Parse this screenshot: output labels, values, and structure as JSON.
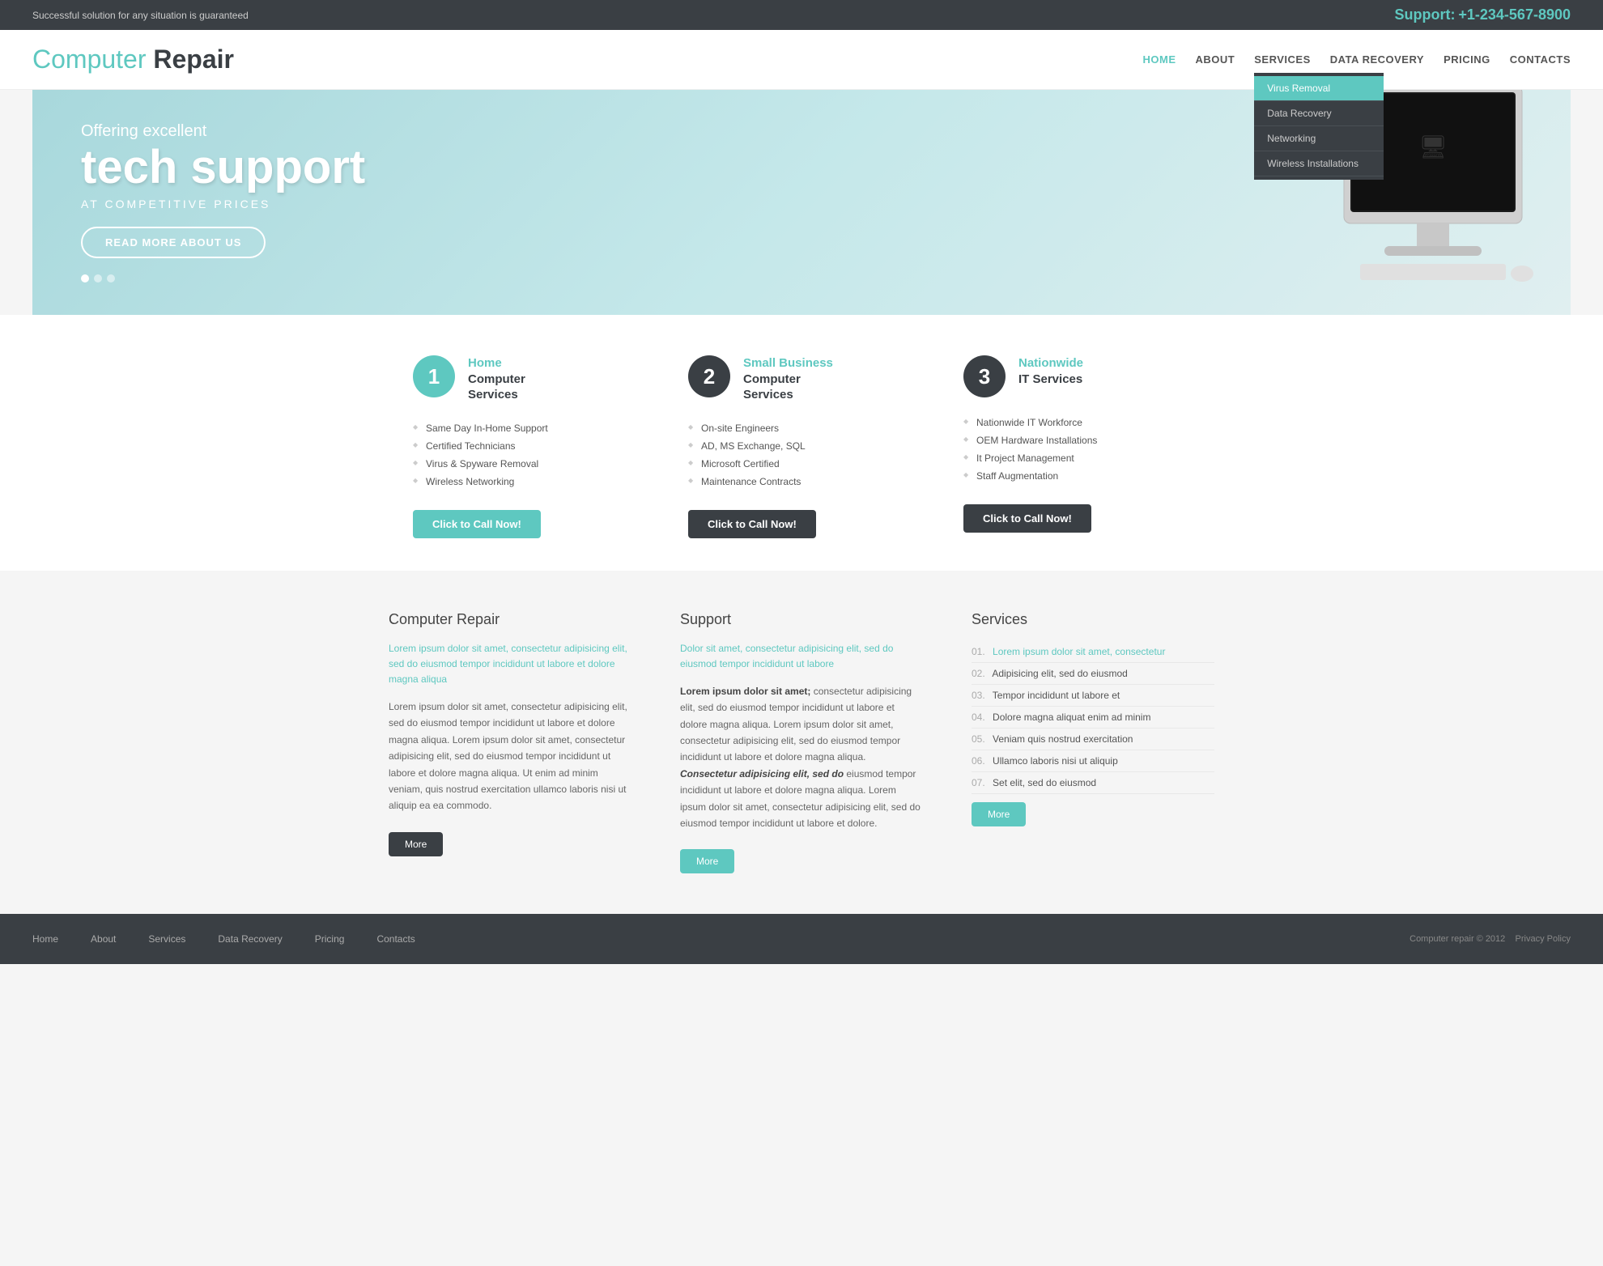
{
  "topbar": {
    "tagline": "Successful solution for any situation is guaranteed",
    "support_label": "Support:",
    "phone": "+1-234-567-8900"
  },
  "header": {
    "logo_teal": "Computer ",
    "logo_bold": "Repair",
    "nav": {
      "items": [
        {
          "label": "HOME",
          "active": true
        },
        {
          "label": "ABOUT",
          "active": false
        },
        {
          "label": "SERVICES",
          "active": false,
          "has_dropdown": true
        },
        {
          "label": "DATA RECOVERY",
          "active": false
        },
        {
          "label": "PRICING",
          "active": false
        },
        {
          "label": "CONTACTS",
          "active": false
        }
      ],
      "dropdown": [
        {
          "label": "Virus Removal",
          "active": true
        },
        {
          "label": "Data Recovery",
          "active": false
        },
        {
          "label": "Networking",
          "active": false
        },
        {
          "label": "Wireless Installations",
          "active": false
        }
      ]
    }
  },
  "hero": {
    "offering": "Offering excellent",
    "headline": "tech support",
    "subheadline": "AT COMPETITIVE PRICES",
    "cta_label": "READ MORE ABOUT US",
    "dots": 3
  },
  "services": [
    {
      "number": "1",
      "dark": false,
      "title_teal": "Home",
      "title_dark": "Computer Services",
      "items": [
        "Same Day In-Home Support",
        "Certified Technicians",
        "Virus & Spyware Removal",
        "Wireless Networking"
      ],
      "btn_label": "Click to Call Now!",
      "btn_dark": false
    },
    {
      "number": "2",
      "dark": true,
      "title_teal": "Small Business",
      "title_dark": "Computer Services",
      "items": [
        "On-site Engineers",
        "AD, MS Exchange, SQL",
        "Microsoft Certified",
        "Maintenance Contracts"
      ],
      "btn_label": "Click to Call Now!",
      "btn_dark": true
    },
    {
      "number": "3",
      "dark": true,
      "title_teal": "Nationwide",
      "title_dark": "IT Services",
      "items": [
        "Nationwide IT Workforce",
        "OEM Hardware Installations",
        "It Project Management",
        "Staff Augmentation"
      ],
      "btn_label": "Click to Call Now!",
      "btn_dark": true
    }
  ],
  "info": {
    "columns": [
      {
        "heading": "Computer Repair",
        "teal_text": "Lorem ipsum dolor sit amet, consectetur adipisicing elit, sed do eiusmod tempor incididunt ut labore et dolore magna aliqua",
        "body": "Lorem ipsum dolor sit amet, consectetur adipisicing elit, sed do eiusmod tempor incididunt ut labore et dolore magna aliqua.  Lorem ipsum dolor sit amet, consectetur adipisicing elit, sed do eiusmod tempor incididunt ut labore et dolore magna aliqua.  Ut enim ad minim veniam, quis nostrud exercitation ullamco laboris nisi ut aliquip ea ea commodo.",
        "btn_label": "More",
        "btn_dark": true
      },
      {
        "heading": "Support",
        "teal_text": "Dolor sit amet, consectetur adipisicing elit, sed do eiusmod tempor incididunt ut labore",
        "body": "Lorem ipsum dolor sit amet, consectetur adipisicing elit, sed do eiusmod tempor incididunt ut labore et dolore magna aliqua.  Lorem ipsum dolor sit amet, consectetur adipisicing elit, sed do eiusmod tempor incididunt ut labore et dolore magna aliqua.  Consectetur adipisicing elit, sed do eiusmod tempor incididunt ut labore et dolore magna aliqua.  Lorem ipsum dolor sit amet, consectetur adipisicing elit, sed do eiusmod tempor incididunt ut labore et dolore.",
        "btn_label": "More",
        "btn_dark": false
      },
      {
        "heading": "Services",
        "services_list": [
          {
            "num": "01.",
            "text": "Lorem ipsum dolor sit amet, consectetur",
            "teal": true
          },
          {
            "num": "02.",
            "text": "Adipisicing elit, sed do eiusmod",
            "teal": false
          },
          {
            "num": "03.",
            "text": "Tempor incididunt ut labore et",
            "teal": false
          },
          {
            "num": "04.",
            "text": "Dolore magna aliquat enim ad minim",
            "teal": false
          },
          {
            "num": "05.",
            "text": "Veniam quis nostrud exercitation",
            "teal": false
          },
          {
            "num": "06.",
            "text": "Ullamco laboris nisi ut aliquip",
            "teal": false
          },
          {
            "num": "07.",
            "text": "Set elit, sed do eiusmod",
            "teal": false
          }
        ],
        "btn_label": "More",
        "btn_dark": false
      }
    ]
  },
  "footer": {
    "links": [
      "Home",
      "About",
      "Services",
      "Data Recovery",
      "Pricing",
      "Contacts"
    ],
    "copyright": "Computer repair © 2012",
    "privacy": "Privacy Policy"
  }
}
